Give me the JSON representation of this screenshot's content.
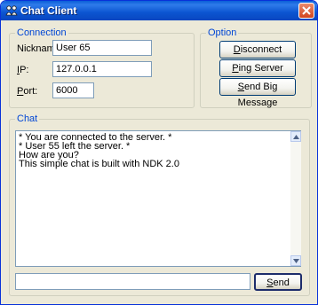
{
  "window": {
    "title": "Chat Client"
  },
  "connection": {
    "legend": "Connection",
    "nickname_label": "Nickname:",
    "nickname_value": "User 65",
    "ip_label_key": "I",
    "ip_label_rest": "P:",
    "ip_value": "127.0.0.1",
    "port_label_key": "P",
    "port_label_rest": "ort:",
    "port_value": "6000"
  },
  "option": {
    "legend": "Option",
    "disconnect_key": "D",
    "disconnect_rest": "isconnect",
    "ping_key": "P",
    "ping_rest": "ing Server",
    "bigmsg_key": "S",
    "bigmsg_rest": "end Big Message"
  },
  "chat": {
    "legend": "Chat",
    "messages": [
      "* You are connected to the server. *",
      "* User 55 left the server. *",
      "How are you?",
      "This simple chat is built with NDK 2.0"
    ],
    "input_value": "",
    "send_key": "S",
    "send_rest": "end"
  },
  "icons": {
    "app": "users-icon",
    "close": "close-icon",
    "scroll_up": "arrow-up-icon",
    "scroll_down": "arrow-down-icon"
  },
  "colors": {
    "title_bar": "#0a5fd8",
    "group_legend": "#0046d5",
    "window_bg": "#ece9d8"
  }
}
